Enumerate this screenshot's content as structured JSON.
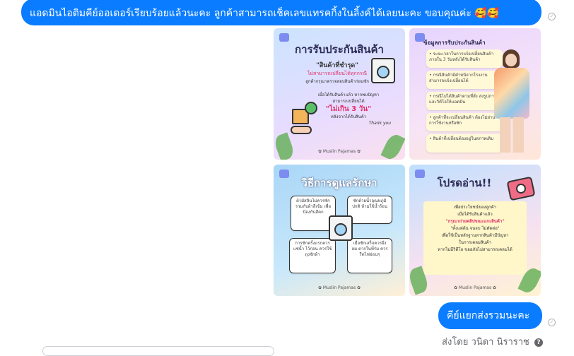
{
  "messages": [
    {
      "text": "แอดมินไอติมคีย์ออเดอร์เรียบร้อยแล้วนะคะ ลูกค้าสามารถเช็คเลขแทรคกิ้งในลิ้งค์ได้เลยนะคะ ขอบคุณค่ะ 🥰🥰",
      "status": "✓"
    },
    {
      "text": "คีย์แยกส่งรวมนะคะ",
      "status": "✓"
    }
  ],
  "sent_by": {
    "label": "ส่งโดย",
    "name": "วนิดา นิราราช",
    "help": "?"
  },
  "images": [
    {
      "title": "การรับประกันสินค้า",
      "line1": "\"สินค้าที่ชำรุด\"",
      "line2": "ไม่สามารถเปลี่ยนได้ทุกกรณี",
      "line3": "ลูกค้ากรุณาตรวจสอบสินค้าก่อนซัก",
      "line4": "เมื่อได้รับสินค้าแล้ว หากพบปัญหา",
      "line5": "สามารถเปลี่ยนได้",
      "highlight": "\"ไม่เกิน 3 วัน\"",
      "line6": "หลังจากได้รับสินค้า",
      "thanks": "Thank you",
      "brand": "✿ Muslin Pajamas ✿"
    },
    {
      "title": "ข้อมูลการรับประกันสินค้า",
      "notes": [
        "• ระยะเวลาในการแจ้งเปลี่ยนสินค้า ภายใน 3 วันหลังได้รับสินค้า",
        "• กรณีสินค้ามีตำหนิจากโรงงาน สามารถแจ้งเปลี่ยนได้",
        "• กรณีไม่ได้สินค้าตามที่สั่ง ส่งรูปภาพและวิดีโอให้แอดมิน",
        "• ลูกค้าที่จะเปลี่ยนสินค้า ต้องไม่ผ่านการใช้งานหรือซัก",
        "• สินค้าที่เปลี่ยนต้องอยู่ในสภาพเดิม"
      ]
    },
    {
      "title": "วิธีการดูแลรักษา",
      "notes": [
        "ผ้ามัสลินไม่ควรซักรวมกับผ้าสีเข้ม เพื่อป้องกันสีตก",
        "ซักด้วยน้ำอุณหภูมิปกติ ห้ามใช้น้ำร้อน",
        "การซักครั้งแรกควรแช่น้ำ ไว้ก่อน ควรใช้ ถุงซักผ้า",
        "เมื่อซักเสร็จควรผึ่งลม ตากในที่ร่ม ควรรีดไฟอ่อนๆ"
      ],
      "brand": "✿ Muslin Pajamas ✿"
    },
    {
      "title": "โปรดอ่าน!!",
      "line1": "เพื่อประโยชน์ของลูกค้า",
      "line2": "เมื่อได้รับสินค้าแล้ว",
      "highlight": "\"กรุณาถ่ายคลิปขณะแกะสินค้า\"",
      "line3": "\"ตั้งแต่ต้น จนจบ ไม่ตัดต่อ\"",
      "line4": "เพื่อใช้เป็นหลักฐานหากสินค้ามีปัญหา",
      "line5": "ในการเคลมสินค้า",
      "line6": "หากไม่มีวิดีโอ ขออภัยไม่สามารถเคลมได้",
      "brand": "✿ Muslin Pajamas ✿"
    }
  ],
  "colors": {
    "bubble": "#0a7cff",
    "bubble_text": "#ffffff",
    "meta_text": "#65676b"
  }
}
